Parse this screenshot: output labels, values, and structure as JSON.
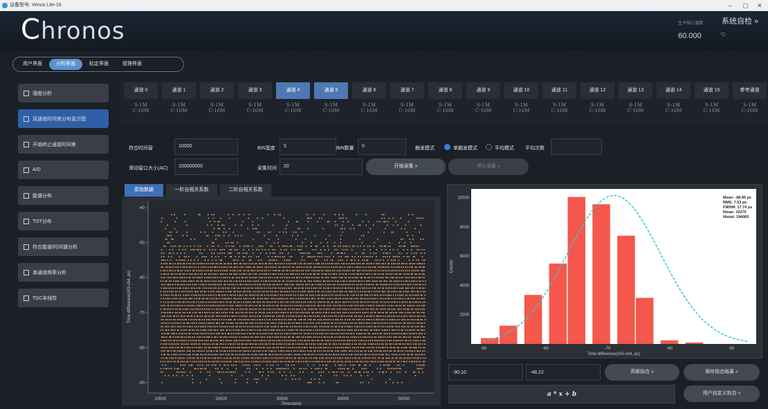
{
  "window": {
    "title": "设备型号: Venus Lite-16",
    "min": "–",
    "max": "▢",
    "close": "✕"
  },
  "header": {
    "logo_initial": "C",
    "logo_rest": "hronos",
    "temp_label": "主卡核心温度",
    "temp_value": "60.000",
    "temp_unit": "°C",
    "self_check": "系统自检 »"
  },
  "nav": {
    "tabs": [
      "用户界面",
      "分析界面",
      "标定界面",
      "管理界面"
    ],
    "active": 1
  },
  "sidebar": {
    "items": [
      {
        "label": "强度分析",
        "icon": "chart-icon"
      },
      {
        "label": "双通道时间差分布直方图",
        "icon": "histogram-icon"
      },
      {
        "label": "开始终止通道时间差",
        "icon": "arrows-icon"
      },
      {
        "label": "A/D",
        "icon": "home-icon"
      },
      {
        "label": "能谱分布",
        "icon": "arrows-icon"
      },
      {
        "label": "TOT分布",
        "icon": "chart-icon"
      },
      {
        "label": "符合能谱/时间谱分析",
        "icon": "arrows-icon"
      },
      {
        "label": "单通道频率分析",
        "icon": "chart-icon"
      },
      {
        "label": "TDC非线性",
        "icon": "chart-icon"
      }
    ],
    "active": 1
  },
  "channels": {
    "items": [
      "通道 0",
      "通道 1",
      "通道 2",
      "通道 3",
      "通道 4",
      "通道 5",
      "通道 6",
      "通道 7",
      "通道 8",
      "通道 9",
      "通道 10",
      "通道 11",
      "通道 12",
      "通道 13",
      "通道 14",
      "通道 15",
      "参考通道"
    ],
    "active": [
      4,
      5
    ],
    "sub1": "S-1M",
    "sub2": "C-16M"
  },
  "controls": {
    "coincidence_window_label": "符合时间窗",
    "coincidence_window": "10000",
    "bin_width_label": "BIN宽度",
    "bin_width": "5",
    "bin_count_label": "BIN数量",
    "bin_count": "0",
    "trigger_label": "触发模式",
    "single_trigger": "单触发模式",
    "average_mode": "平均模式",
    "average_count_label": "平均次数",
    "average_count": "",
    "sliding_window_label": "滑动窗口大小(AC)",
    "sliding_window": "100000000",
    "acq_time_label": "采集时间",
    "acq_time": "20",
    "start_btn": "开始采集 »",
    "stop_btn": "停止采集 »"
  },
  "plot_tabs": {
    "items": [
      "原始数据",
      "一阶自相关系数",
      "二阶自相关系数"
    ],
    "active": 0
  },
  "bottom": {
    "left_value": "-90.10",
    "right_value": "-48.22",
    "gauss_btn": "高斯拟合 »",
    "save_btn": "保存拟合结果 »",
    "formula": "a * x + b",
    "custom_btn": "用户自定义拟合 »"
  },
  "chart_data": [
    {
      "type": "scatter",
      "xlabel": "Timestamp",
      "ylabel": "Time difference(ch5-ch4, ps)",
      "xticks": [
        "10000",
        "20000",
        "30000",
        "40000",
        "50000"
      ],
      "yticks": [
        "-40",
        "-50",
        "-60",
        "-70",
        "-80",
        "-90"
      ],
      "xlim": [
        8000,
        55000
      ],
      "ylim": [
        -93,
        -38
      ],
      "color": "#f2a05a"
    },
    {
      "type": "bar",
      "xlabel": "Time difference(ch5-ch4, ps)",
      "ylabel": "Counts",
      "categories": [
        -89,
        -86,
        -82,
        -78,
        -75,
        -71,
        -67,
        -64,
        -60,
        -56,
        -53,
        -49
      ],
      "values": [
        400,
        1250,
        3350,
        5500,
        10050,
        9550,
        7400,
        3150,
        250,
        100,
        0,
        0
      ],
      "xticks": [
        "-90",
        "-80",
        "-70",
        "-60",
        "-50"
      ],
      "yticks": [
        "2000",
        "4000",
        "6000",
        "8000",
        "10000"
      ],
      "xlim": [
        -92,
        -46
      ],
      "ylim": [
        0,
        10600
      ],
      "bar_color": "#f4574b",
      "fit_color": "#39c5d6",
      "fit": {
        "mean": -68.96,
        "sigma": 7.53,
        "amplitude": 10150
      },
      "stats": [
        "Mean: -68.96 ps",
        "RMS: 7.53 ps",
        "FWHM: 17.74 ps",
        "Nmax: 10275",
        "Ntotal: 194065"
      ]
    }
  ]
}
